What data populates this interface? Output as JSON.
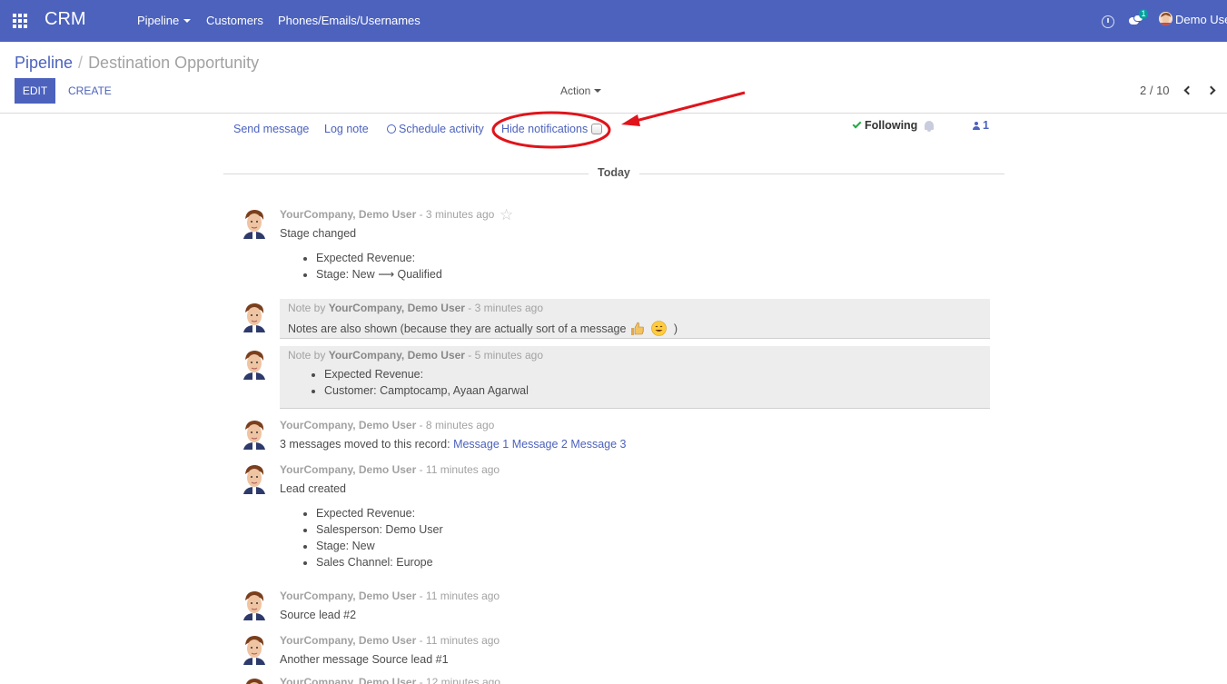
{
  "navbar": {
    "brand": "CRM",
    "menu": [
      "Pipeline",
      "Customers",
      "Phones/Emails/Usernames"
    ],
    "chat_badge": "1",
    "user": "Demo User",
    "colors": {
      "bar": "#4c62bd",
      "badge": "#00a09d"
    }
  },
  "control": {
    "breadcrumb_root": "Pipeline",
    "breadcrumb_sep": "/",
    "breadcrumb_current": "Destination Opportunity",
    "edit": "EDIT",
    "create": "CREATE",
    "action": "Action",
    "pager": "2 / 10"
  },
  "chatter": {
    "send_message": "Send message",
    "log_note": "Log note",
    "schedule_activity": "Schedule activity",
    "hide_notifications": "Hide notifications",
    "following": "Following",
    "followers_count": "1",
    "day_separator": "Today"
  },
  "messages": [
    {
      "author": "YourCompany, Demo User",
      "time": " - 3 minutes ago",
      "body": "Stage changed",
      "tracking": [
        "Expected Revenue:",
        "Stage: New ⟶ Qualified"
      ]
    },
    {
      "note_prefix": "Note by ",
      "author": "YourCompany, Demo User",
      "time": " - 3 minutes ago",
      "body": "Notes are also shown (because they are actually sort of a message",
      "body_end": ")"
    },
    {
      "note_prefix": "Note by ",
      "author": "YourCompany, Demo User",
      "time": " - 5 minutes ago",
      "tracking": [
        "Expected Revenue:",
        "Customer: Camptocamp, Ayaan Agarwal"
      ]
    },
    {
      "author": "YourCompany, Demo User",
      "time": " - 8 minutes ago",
      "body": "3 messages moved to this record: ",
      "links": [
        "Message 1",
        "Message 2",
        "Message 3"
      ]
    },
    {
      "author": "YourCompany, Demo User",
      "time": " - 11 minutes ago",
      "body": "Lead created",
      "tracking": [
        "Expected Revenue:",
        "Salesperson: Demo User",
        "Stage: New",
        "Sales Channel: Europe"
      ]
    },
    {
      "author": "YourCompany, Demo User",
      "time": " - 11 minutes ago",
      "body": "Source lead #2"
    },
    {
      "author": "YourCompany, Demo User",
      "time": " - 11 minutes ago",
      "body": "Another message Source lead #1"
    },
    {
      "author": "YourCompany, Demo User",
      "time": " - 12 minutes ago"
    }
  ]
}
